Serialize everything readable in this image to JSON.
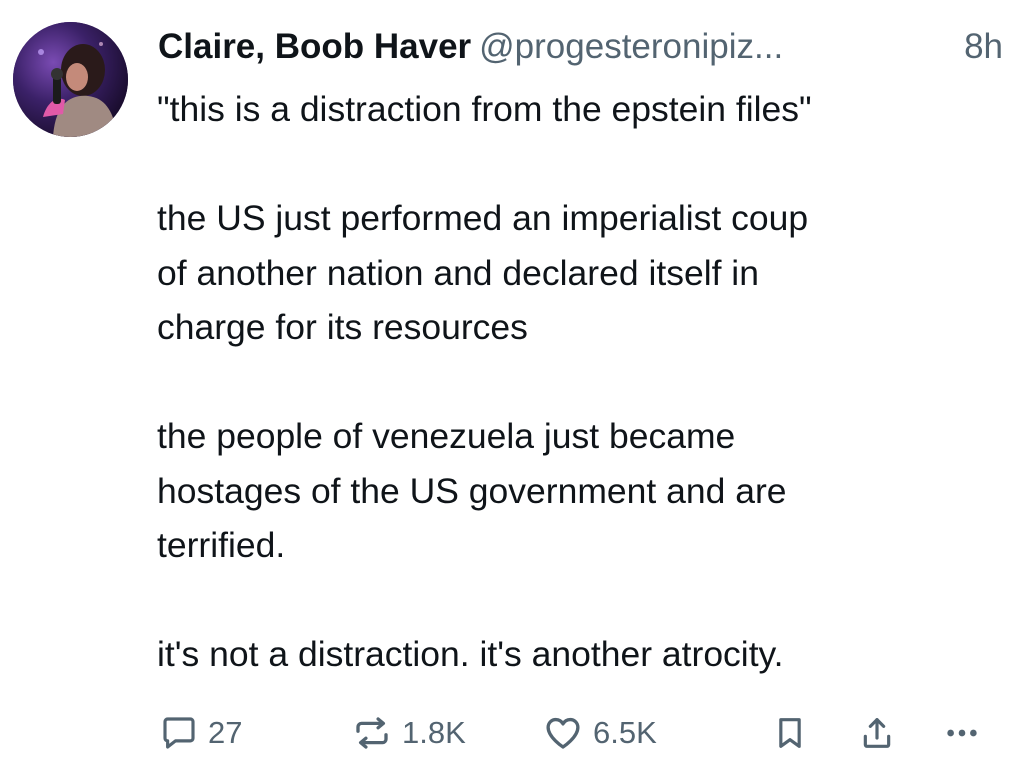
{
  "post": {
    "author": {
      "display_name": "Claire, Boob Haver",
      "handle": "@progesteronipiz...",
      "time_ago": "8h",
      "avatar_icon": "profile-photo"
    },
    "paragraphs": [
      [
        "\"this is a distraction from the epstein files\""
      ],
      [
        "the US just performed an imperialist coup",
        "of another nation and declared itself in",
        "charge for its resources"
      ],
      [
        "the people of venezuela just became",
        "hostages of the US government and are",
        "terrified."
      ],
      [
        "it's not a distraction. it's another atrocity."
      ]
    ],
    "actions": {
      "reply_count": "27",
      "repost_count": "1.8K",
      "like_count": "6.5K"
    }
  },
  "colors": {
    "text_primary": "#0f1419",
    "text_secondary": "#536471",
    "icon": "#536471",
    "background": "#ffffff"
  }
}
